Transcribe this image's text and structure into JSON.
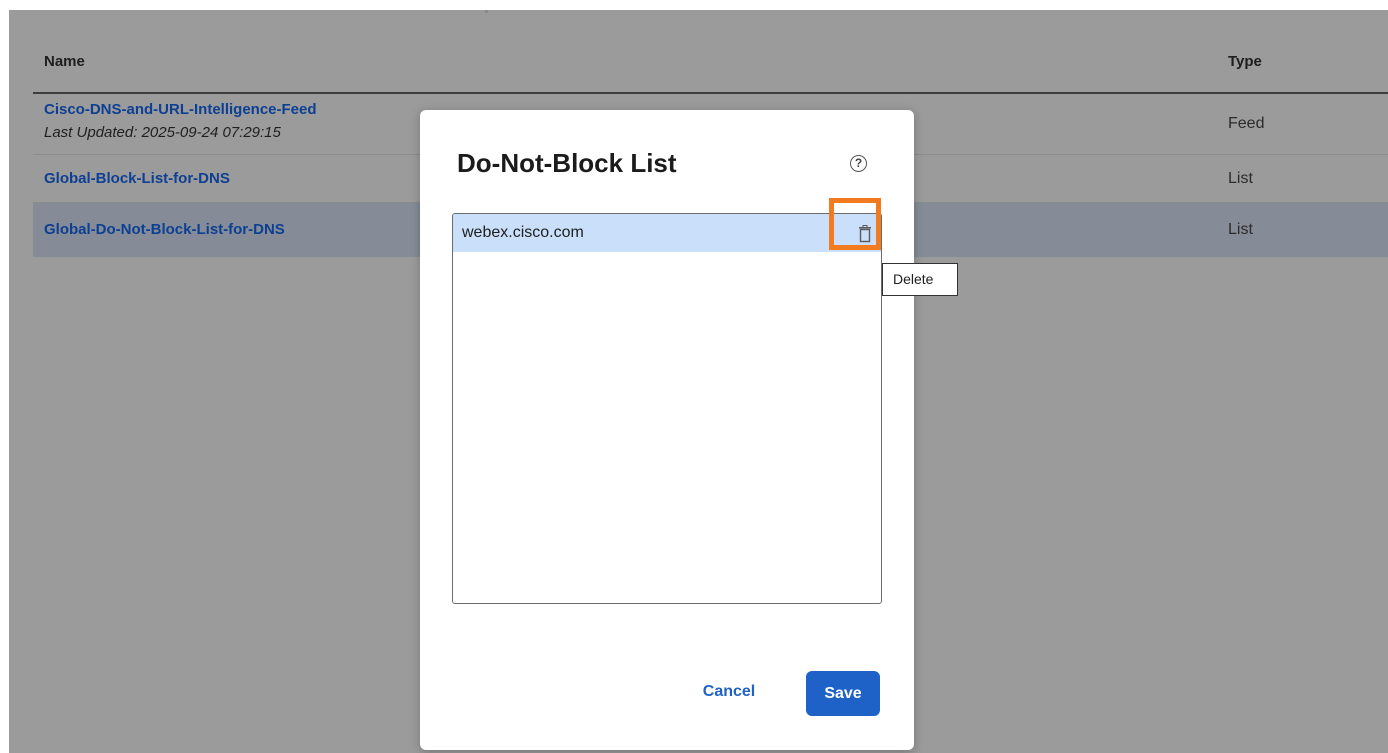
{
  "table": {
    "headers": {
      "name": "Name",
      "type": "Type"
    },
    "rows": [
      {
        "name": "Cisco-DNS-and-URL-Intelligence-Feed",
        "sub": "Last Updated: 2025-09-24 07:29:15",
        "type": "Feed"
      },
      {
        "name": "Global-Block-List-for-DNS",
        "type": "List"
      },
      {
        "name": "Global-Do-Not-Block-List-for-DNS",
        "type": "List"
      }
    ]
  },
  "modal": {
    "title": "Do-Not-Block List",
    "help_icon": "question-circle-icon",
    "items": [
      {
        "value": "webex.cisco.com"
      }
    ],
    "delete_tooltip": "Delete",
    "cancel_label": "Cancel",
    "save_label": "Save"
  },
  "colors": {
    "link": "#0d3f93",
    "accent": "#1e62c8",
    "highlight": "#f27b1f",
    "selected_item": "#c9dffa",
    "overlay": "#9b9b9b"
  }
}
